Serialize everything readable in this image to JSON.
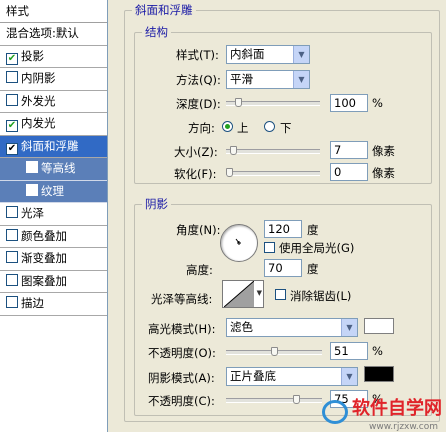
{
  "styles_list": {
    "header": "样式",
    "blend_options": "混合选项:默认",
    "items": [
      {
        "label": "投影",
        "checked": true
      },
      {
        "label": "内阴影",
        "checked": false
      },
      {
        "label": "外发光",
        "checked": false
      },
      {
        "label": "内发光",
        "checked": true
      },
      {
        "label": "斜面和浮雕",
        "checked": true,
        "selected": true
      },
      {
        "label": "等高线",
        "checked": false,
        "sub": true
      },
      {
        "label": "纹理",
        "checked": false,
        "sub": true
      },
      {
        "label": "光泽",
        "checked": false
      },
      {
        "label": "颜色叠加",
        "checked": false
      },
      {
        "label": "渐变叠加",
        "checked": false
      },
      {
        "label": "图案叠加",
        "checked": false
      },
      {
        "label": "描边",
        "checked": false
      }
    ]
  },
  "bevel": {
    "title": "斜面和浮雕",
    "structure": {
      "title": "结构",
      "style_label": "样式(T):",
      "style_value": "内斜面",
      "method_label": "方法(Q):",
      "method_value": "平滑",
      "depth_label": "深度(D):",
      "depth_value": "100",
      "depth_unit": "%",
      "direction_label": "方向:",
      "dir_up": "上",
      "dir_down": "下",
      "size_label": "大小(Z):",
      "size_value": "7",
      "size_unit": "像素",
      "soften_label": "软化(F):",
      "soften_value": "0",
      "soften_unit": "像素"
    },
    "shading": {
      "title": "阴影",
      "angle_label": "角度(N):",
      "angle_value": "120",
      "angle_unit": "度",
      "global_light_label": "使用全局光(G)",
      "altitude_label": "高度:",
      "altitude_value": "70",
      "altitude_unit": "度",
      "gloss_contour_label": "光泽等高线:",
      "anti_alias_label": "消除锯齿(L)",
      "highlight_mode_label": "高光模式(H):",
      "highlight_mode_value": "滤色",
      "highlight_opacity_label": "不透明度(O):",
      "highlight_opacity_value": "51",
      "shadow_mode_label": "阴影模式(A):",
      "shadow_mode_value": "正片叠底",
      "shadow_opacity_label": "不透明度(C):",
      "shadow_opacity_value": "75",
      "percent": "%"
    }
  },
  "colors": {
    "highlight": "#ffffff",
    "shadow": "#000000",
    "accent": "#316ac5"
  },
  "levels": {
    "depth": 0.1,
    "size": 0.05,
    "soften": 0.0,
    "highlight_opacity": 0.51,
    "shadow_opacity": 0.75
  },
  "watermark": {
    "text": "软件自学网",
    "url": "www.rjzxw.com"
  }
}
